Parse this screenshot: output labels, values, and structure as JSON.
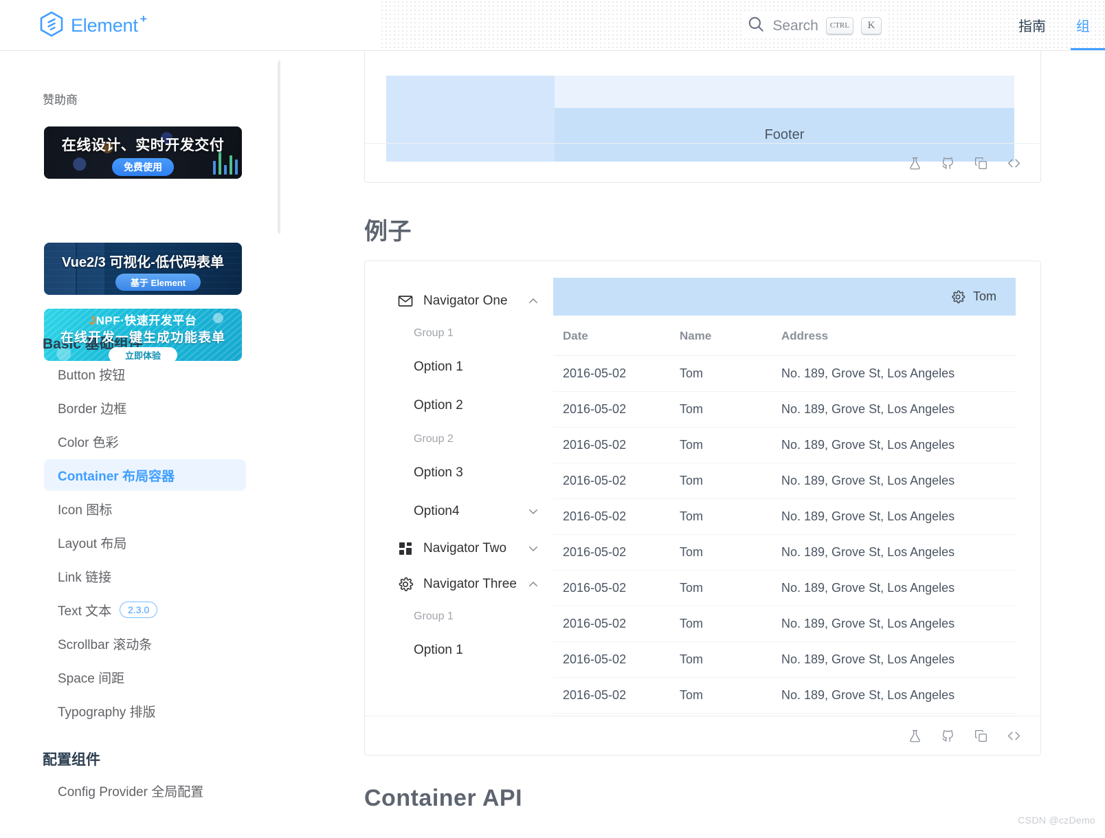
{
  "header": {
    "logo_text": "Element",
    "logo_plus": "+",
    "search": {
      "label": "Search",
      "key_ctrl": "CTRL",
      "key_letter": "K"
    },
    "nav": [
      {
        "label": "指南",
        "active": false
      },
      {
        "label": "组",
        "active": true
      }
    ]
  },
  "sidebar": {
    "sponsor_title": "赞助商",
    "ads": [
      {
        "headline": "在线设计、实时开发交付",
        "button": "免费使用"
      },
      {
        "headline": "Vue2/3 可视化-低代码表单",
        "button": "基于 Element"
      },
      {
        "brand_j": "J",
        "brand_rest": "NPF·快速开发平台",
        "headline": "在线开发一键生成功能表单",
        "button": "立即体验"
      }
    ],
    "groups": [
      {
        "title": "Basic 基础组件",
        "items": [
          {
            "label": "Button 按钮",
            "active": false,
            "badge": ""
          },
          {
            "label": "Border 边框",
            "active": false,
            "badge": ""
          },
          {
            "label": "Color 色彩",
            "active": false,
            "badge": ""
          },
          {
            "label": "Container 布局容器",
            "active": true,
            "badge": ""
          },
          {
            "label": "Icon 图标",
            "active": false,
            "badge": ""
          },
          {
            "label": "Layout 布局",
            "active": false,
            "badge": ""
          },
          {
            "label": "Link 链接",
            "active": false,
            "badge": ""
          },
          {
            "label": "Text 文本",
            "active": false,
            "badge": "2.3.0"
          },
          {
            "label": "Scrollbar 滚动条",
            "active": false,
            "badge": ""
          },
          {
            "label": "Space 间距",
            "active": false,
            "badge": ""
          },
          {
            "label": "Typography 排版",
            "active": false,
            "badge": ""
          }
        ]
      },
      {
        "title": "配置组件",
        "items": [
          {
            "label": "Config Provider 全局配置",
            "active": false,
            "badge": ""
          }
        ]
      }
    ]
  },
  "main": {
    "layout_demo": {
      "footer_label": "Footer"
    },
    "headings": {
      "examples": "例子",
      "api": "Container API"
    },
    "card_actions": [
      {
        "icon": "flask-icon",
        "title": "playground"
      },
      {
        "icon": "github-icon",
        "title": "github"
      },
      {
        "icon": "copy-icon",
        "title": "copy"
      },
      {
        "icon": "code-icon",
        "title": "source"
      }
    ],
    "example": {
      "menu": [
        {
          "type": "submenu",
          "icon": "message-icon",
          "label": "Navigator One",
          "expanded": true
        },
        {
          "type": "group",
          "label": "Group 1"
        },
        {
          "type": "option",
          "label": "Option 1",
          "has_chevron": false
        },
        {
          "type": "option",
          "label": "Option 2",
          "has_chevron": false
        },
        {
          "type": "group",
          "label": "Group 2"
        },
        {
          "type": "option",
          "label": "Option 3",
          "has_chevron": false
        },
        {
          "type": "option",
          "label": "Option4",
          "has_chevron": true
        },
        {
          "type": "submenu",
          "icon": "grid-icon",
          "label": "Navigator Two",
          "expanded": false
        },
        {
          "type": "submenu",
          "icon": "gear-icon",
          "label": "Navigator Three",
          "expanded": true
        },
        {
          "type": "group",
          "label": "Group 1"
        },
        {
          "type": "option",
          "label": "Option 1",
          "has_chevron": false
        }
      ],
      "header": {
        "user": "Tom"
      },
      "table": {
        "columns": [
          "Date",
          "Name",
          "Address"
        ],
        "rows": [
          [
            "2016-05-02",
            "Tom",
            "No. 189, Grove St, Los Angeles"
          ],
          [
            "2016-05-02",
            "Tom",
            "No. 189, Grove St, Los Angeles"
          ],
          [
            "2016-05-02",
            "Tom",
            "No. 189, Grove St, Los Angeles"
          ],
          [
            "2016-05-02",
            "Tom",
            "No. 189, Grove St, Los Angeles"
          ],
          [
            "2016-05-02",
            "Tom",
            "No. 189, Grove St, Los Angeles"
          ],
          [
            "2016-05-02",
            "Tom",
            "No. 189, Grove St, Los Angeles"
          ],
          [
            "2016-05-02",
            "Tom",
            "No. 189, Grove St, Los Angeles"
          ],
          [
            "2016-05-02",
            "Tom",
            "No. 189, Grove St, Los Angeles"
          ],
          [
            "2016-05-02",
            "Tom",
            "No. 189, Grove St, Los Angeles"
          ],
          [
            "2016-05-02",
            "Tom",
            "No. 189, Grove St, Los Angeles"
          ]
        ]
      }
    }
  },
  "watermark": "CSDN @czDemo",
  "colors": {
    "accent": "#409eff",
    "active_bg": "#ecf5ff",
    "demo_blue": "#c6e0fa",
    "demo_blue_light": "#eaf2fd",
    "demo_aside": "#d3e6fb"
  }
}
